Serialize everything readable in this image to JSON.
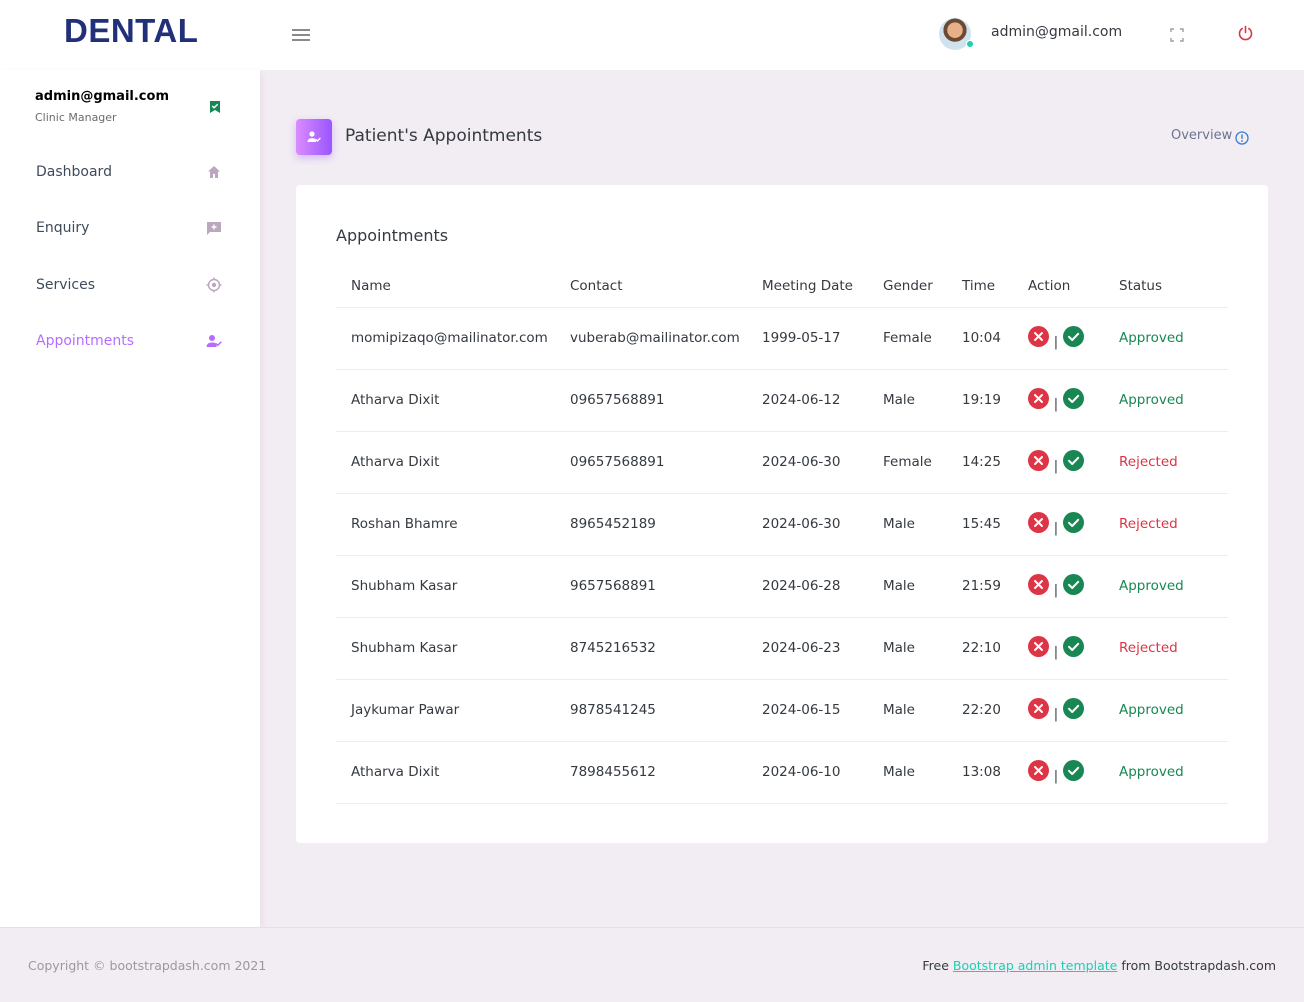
{
  "navbar": {
    "brand": "DENTAL",
    "user_email": "admin@gmail.com"
  },
  "sidebar": {
    "profile_name": "admin@gmail.com",
    "profile_role": "Clinic Manager",
    "items": [
      {
        "label": "Dashboard",
        "icon": "home-icon"
      },
      {
        "label": "Enquiry",
        "icon": "message-plus-icon"
      },
      {
        "label": "Services",
        "icon": "crosshairs-icon"
      },
      {
        "label": "Appointments",
        "icon": "account-check-icon",
        "active": true
      }
    ]
  },
  "page": {
    "title": "Patient's Appointments",
    "overview_label": "Overview"
  },
  "appointments": {
    "card_title": "Appointments",
    "headers": [
      "Name",
      "Contact",
      "Meeting Date",
      "Gender",
      "Time",
      "Action",
      "Status"
    ],
    "rows": [
      {
        "name": "momipizaqo@mailinator.com",
        "contact": "vuberab@mailinator.com",
        "date": "1999-05-17",
        "gender": "Female",
        "time": "10:04",
        "status": "Approved"
      },
      {
        "name": "Atharva Dixit",
        "contact": "09657568891",
        "date": "2024-06-12",
        "gender": "Male",
        "time": "19:19",
        "status": "Approved"
      },
      {
        "name": "Atharva Dixit",
        "contact": "09657568891",
        "date": "2024-06-30",
        "gender": "Female",
        "time": "14:25",
        "status": "Rejected"
      },
      {
        "name": "Roshan Bhamre",
        "contact": "8965452189",
        "date": "2024-06-30",
        "gender": "Male",
        "time": "15:45",
        "status": "Rejected"
      },
      {
        "name": "Shubham Kasar",
        "contact": "9657568891",
        "date": "2024-06-28",
        "gender": "Male",
        "time": "21:59",
        "status": "Approved"
      },
      {
        "name": "Shubham Kasar",
        "contact": "8745216532",
        "date": "2024-06-23",
        "gender": "Male",
        "time": "22:10",
        "status": "Rejected"
      },
      {
        "name": "Jaykumar Pawar",
        "contact": "9878541245",
        "date": "2024-06-15",
        "gender": "Male",
        "time": "22:20",
        "status": "Approved"
      },
      {
        "name": "Atharva Dixit",
        "contact": "7898455612",
        "date": "2024-06-10",
        "gender": "Male",
        "time": "13:08",
        "status": "Approved"
      }
    ],
    "action_separator": "|"
  },
  "footer": {
    "copyright": "Copyright © bootstrapdash.com 2021",
    "credit_prefix": "Free ",
    "credit_link": "Bootstrap admin template",
    "credit_suffix": " from Bootstrapdash.com"
  },
  "colors": {
    "brand": "#22307a",
    "accent": "#b66dff",
    "approved": "#198754",
    "rejected": "#dc3545",
    "link": "#1bcfb4"
  }
}
